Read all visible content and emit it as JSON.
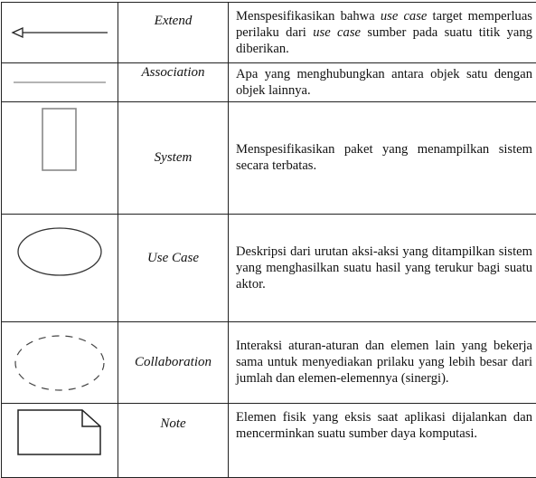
{
  "rows": [
    {
      "symbol_icon": "extend-arrow-icon",
      "name": "Extend",
      "desc_parts": [
        "Menspesifikasikan bahwa ",
        "use case",
        " target memperluas perilaku dari ",
        "use case",
        " sumber pada suatu titik yang diberikan."
      ]
    },
    {
      "symbol_icon": "association-line-icon",
      "name": "Association",
      "description": "Apa yang menghubungkan antara objek satu dengan objek lainnya."
    },
    {
      "symbol_icon": "system-rectangle-icon",
      "name": "System",
      "description": "Menspesifikasikan paket yang menampilkan sistem secara terbatas."
    },
    {
      "symbol_icon": "use-case-ellipse-icon",
      "name": "Use Case",
      "description": "Deskripsi dari urutan aksi-aksi yang ditampilkan sistem yang menghasilkan suatu hasil yang terukur bagi suatu aktor."
    },
    {
      "symbol_icon": "collaboration-dashed-ellipse-icon",
      "name": "Collaboration",
      "description": "Interaksi aturan-aturan dan elemen lain yang bekerja sama untuk menyediakan prilaku yang lebih besar dari jumlah dan elemen-elemennya (sinergi)."
    },
    {
      "symbol_icon": "note-icon",
      "name": "Note",
      "description": "Elemen fisik yang eksis saat aplikasi dijalankan dan mencerminkan suatu sumber daya komputasi."
    }
  ]
}
